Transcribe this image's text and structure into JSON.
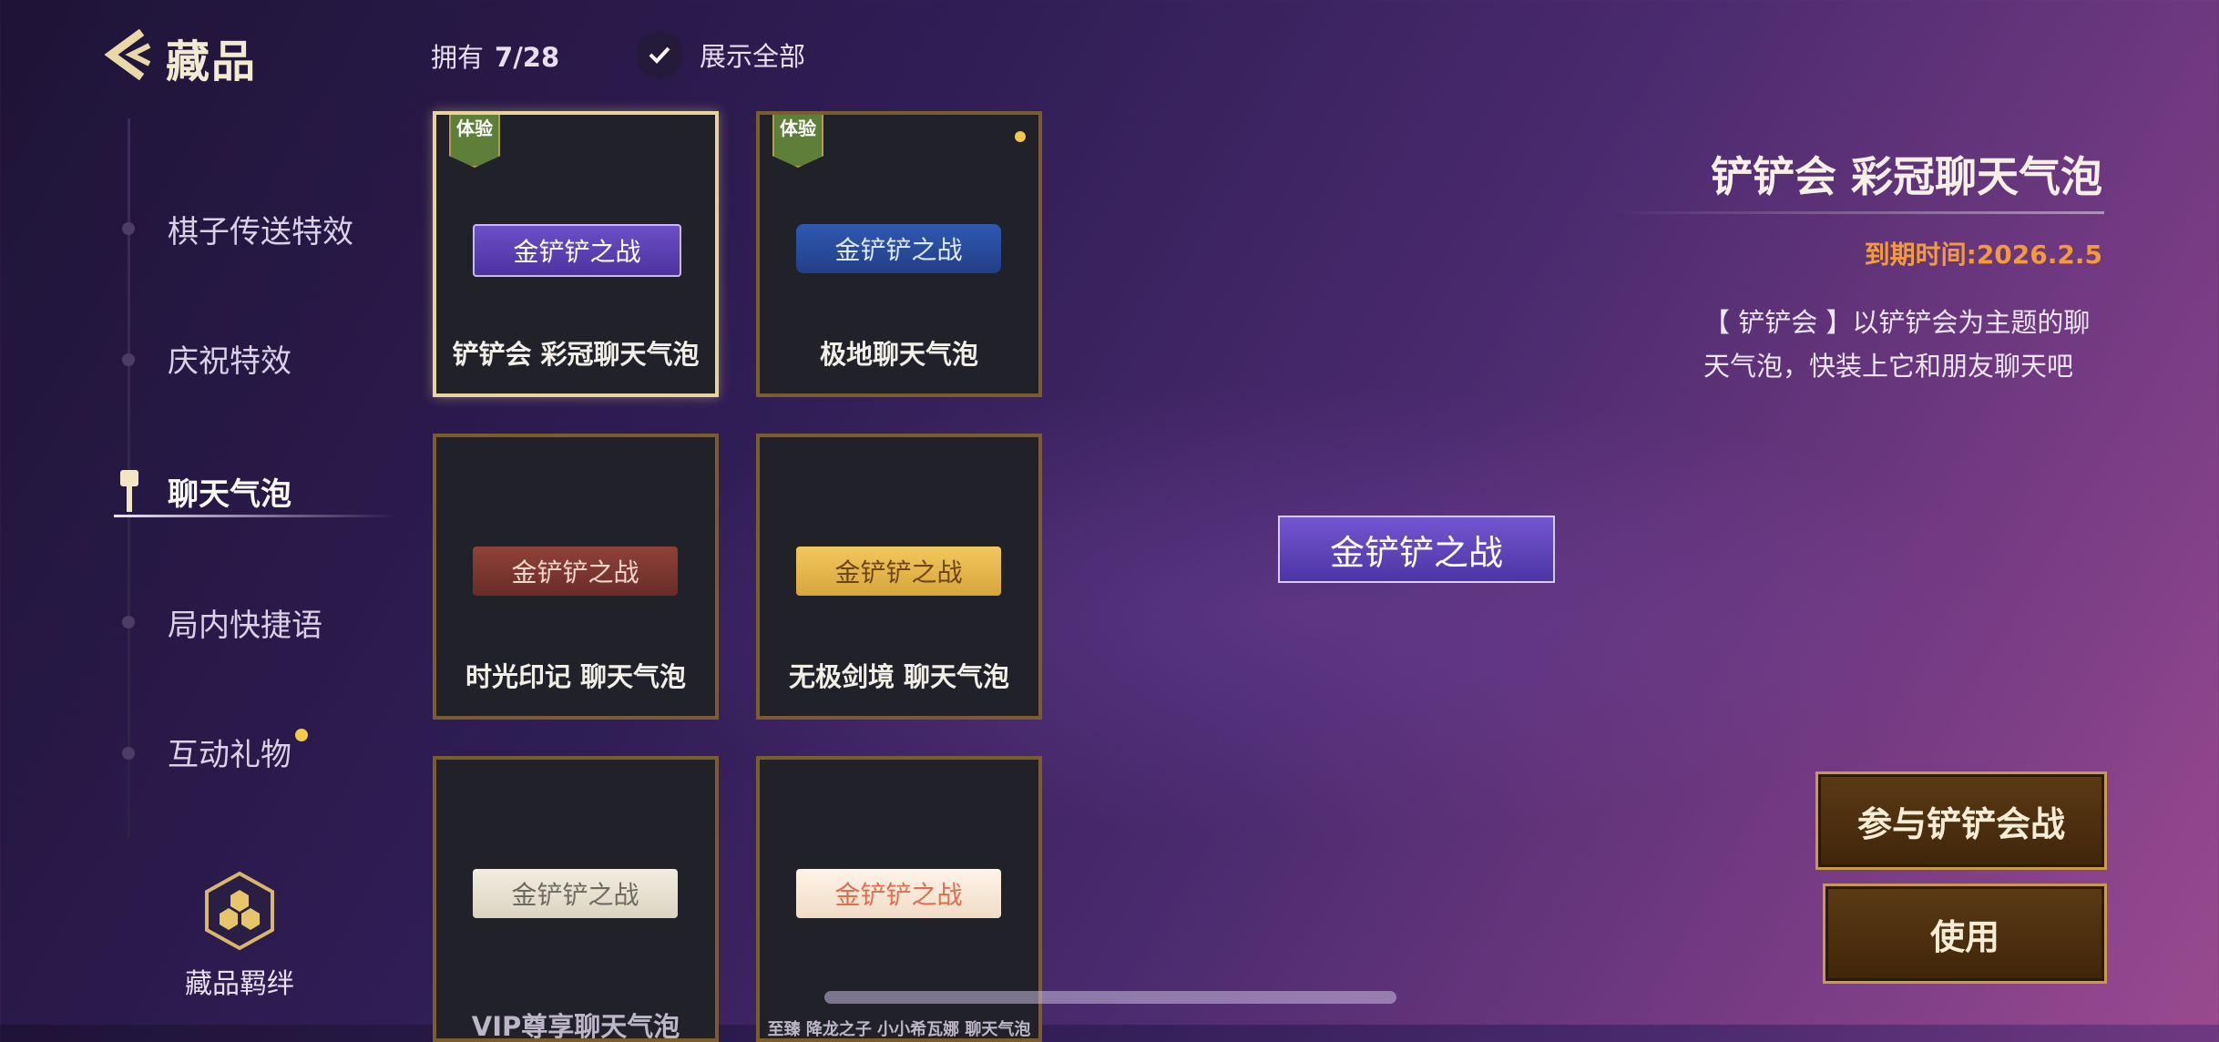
{
  "header": {
    "title": "藏品",
    "owned_label": "拥有",
    "owned_value": "7/28",
    "show_all_label": "展示全部"
  },
  "sidebar": {
    "items": [
      {
        "label": "棋子传送特效"
      },
      {
        "label": "庆祝特效"
      },
      {
        "label": "聊天气泡",
        "active": true
      },
      {
        "label": "局内快捷语"
      },
      {
        "label": "互动礼物",
        "badge": true
      }
    ],
    "bond_label": "藏品羁绊"
  },
  "grid": {
    "cards": [
      {
        "name": "铲铲会 彩冠聊天气泡",
        "tag": "体验",
        "bubble_text": "金铲铲之战",
        "selected": true
      },
      {
        "name": "极地聊天气泡",
        "tag": "体验",
        "bubble_text": "金铲铲之战"
      },
      {
        "name": "时光印记 聊天气泡",
        "bubble_text": "金铲铲之战"
      },
      {
        "name": "无极剑境 聊天气泡",
        "bubble_text": "金铲铲之战"
      },
      {
        "name": "VIP尊享聊天气泡",
        "bubble_text": "金铲铲之战"
      },
      {
        "name": "至臻 降龙之子 小小希瓦娜 聊天气泡",
        "bubble_text": "金铲铲之战"
      }
    ]
  },
  "detail": {
    "title": "铲铲会 彩冠聊天气泡",
    "expire": "到期时间:2026.2.5",
    "description": "【 铲铲会 】以铲铲会为主题的聊天气泡，快装上它和朋友聊天吧",
    "preview_text": "金铲铲之战",
    "join_button": "参与铲铲会战",
    "use_button": "使用"
  },
  "colors": {
    "accent_gold": "#c89a4a",
    "expire_orange": "#f39a3a",
    "selected_border": "#e8d49a"
  }
}
